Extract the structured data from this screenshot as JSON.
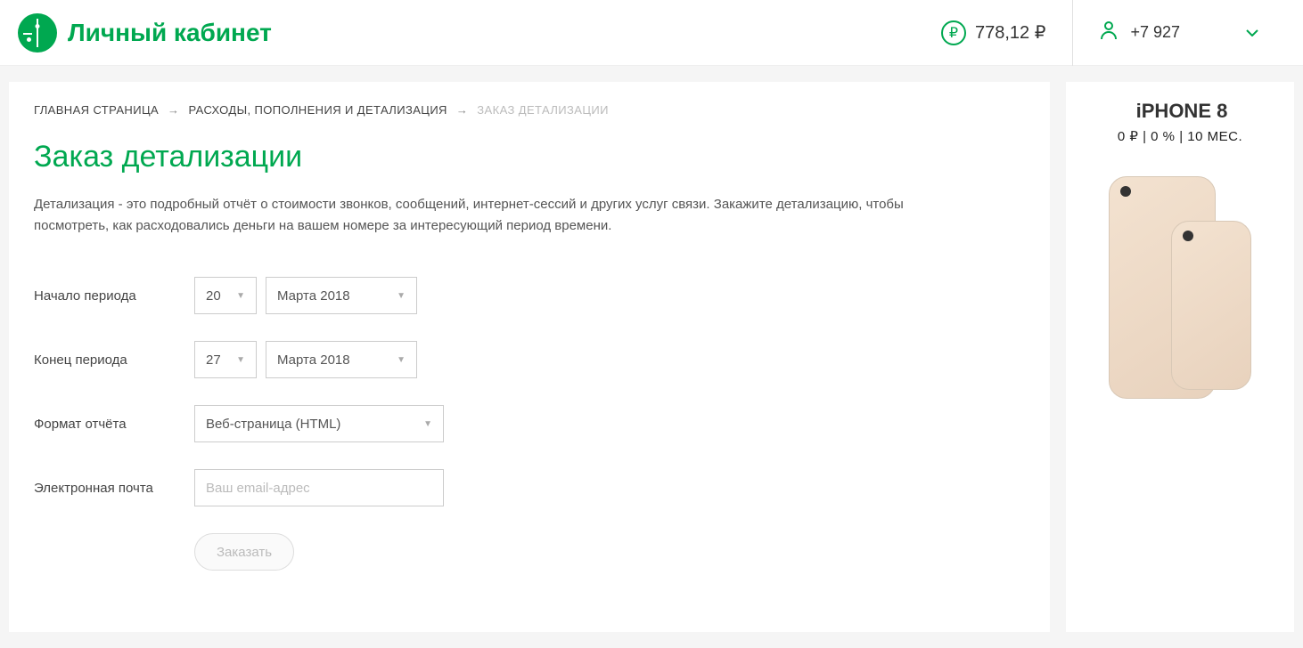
{
  "header": {
    "logo_text": "Личный кабинет",
    "balance": "778,12 ₽",
    "phone": "+7 927"
  },
  "breadcrumb": {
    "home": "ГЛАВНАЯ СТРАНИЦА",
    "section": "РАСХОДЫ, ПОПОЛНЕНИЯ И ДЕТАЛИЗАЦИЯ",
    "current": "ЗАКАЗ ДЕТАЛИЗАЦИИ"
  },
  "page": {
    "title": "Заказ детализации",
    "description": "Детализация - это подробный отчёт о стоимости звонков, сообщений, интернет-сессий и других услуг связи. Закажите детализацию, чтобы посмотреть, как расходовались деньги на вашем номере за интересующий период времени."
  },
  "form": {
    "start_label": "Начало периода",
    "start_day": "20",
    "start_month": "Марта 2018",
    "end_label": "Конец периода",
    "end_day": "27",
    "end_month": "Марта 2018",
    "format_label": "Формат отчёта",
    "format_value": "Веб-страница (HTML)",
    "email_label": "Электронная почта",
    "email_placeholder": "Ваш email-адрес",
    "submit": "Заказать"
  },
  "promo": {
    "title": "iPHONE 8",
    "line": "0 ₽ | 0 % | 10 МЕС."
  }
}
